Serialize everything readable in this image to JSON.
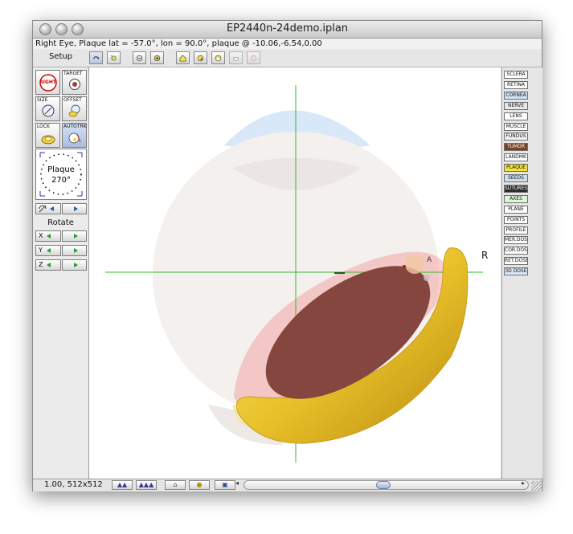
{
  "window": {
    "title": "EP2440n-24demo.iplan",
    "info": "Right Eye, Plaque lat = -57.0°, lon = 90.0°, plaque @ -10.06,-6.54,0.00"
  },
  "toolbar": {
    "setup_label": "Setup",
    "tool_icons": [
      "rotate-icon",
      "pan-icon",
      "zoom-out-icon",
      "zoom-in-icon",
      "home-view-icon",
      "view-b-icon",
      "view-c-icon",
      "view-d-icon",
      "view-e-icon"
    ]
  },
  "left_panel": {
    "right_label": "RIGHT",
    "target_label": "TARGET",
    "size_label": "SIZE",
    "offset_label": "OFFSET",
    "lock_label": "LOCK",
    "autotrk_label": "AUTOTRK",
    "dial_title": "Plaque",
    "dial_value": "270°",
    "rotate_label": "Rotate",
    "axes": [
      "X",
      "Y",
      "Z"
    ]
  },
  "right_panel": {
    "buttons": [
      {
        "label": "SCLERA",
        "bg": "#ffffff"
      },
      {
        "label": "RETINA",
        "bg": "#ffffff"
      },
      {
        "label": "CORNEA",
        "bg": "#cfe3f6"
      },
      {
        "label": "NERVE",
        "bg": "#e8e8e8"
      },
      {
        "label": "LENS",
        "bg": "#ffffff"
      },
      {
        "label": "MUSCLE",
        "bg": "#ffffff"
      },
      {
        "label": "FUNDUS",
        "bg": "#f2f2f2"
      },
      {
        "label": "TUMOR",
        "bg": "#7a4326",
        "fg": "#ffffff"
      },
      {
        "label": "LANDMK",
        "bg": "#ffffff"
      },
      {
        "label": "PLAQUE",
        "bg": "#f6e43a"
      },
      {
        "label": "SEEDS",
        "bg": "#cde0f1"
      },
      {
        "label": "SUTURES",
        "bg": "#2d2d2d",
        "fg": "#ffffff"
      },
      {
        "label": "AXES",
        "bg": "#dff6d6"
      },
      {
        "label": "PLANE",
        "bg": "#ffffff"
      },
      {
        "label": "POINTS",
        "bg": "#ffffff"
      },
      {
        "label": "PROFILE",
        "bg": "#ffffff"
      },
      {
        "label": "MER.DOSE",
        "bg": "#ffffff"
      },
      {
        "label": "COR.DOSE",
        "bg": "#ffffff"
      },
      {
        "label": "RET.DOSE",
        "bg": "#ffffff"
      },
      {
        "label": "3D DOSE",
        "bg": "#d9e8f6"
      }
    ]
  },
  "viewport": {
    "label_a": "A",
    "label_r": "R"
  },
  "statusbar": {
    "text": "1.00, 512x512",
    "buttons": [
      "mountain-small-icon",
      "mountain-large-icon",
      "home-icon",
      "plaque-icon",
      "layers-icon"
    ]
  },
  "colors": {
    "plaque": "#e9c22a",
    "tumor": "#864640",
    "cornea": "#d7e7f8",
    "axes": "#2bbd2b"
  }
}
